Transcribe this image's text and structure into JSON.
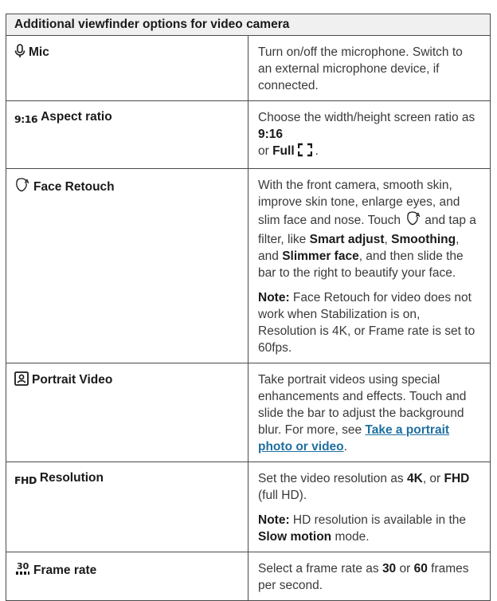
{
  "table": {
    "header": "Additional viewfinder options for video camera",
    "rows": [
      {
        "icon": "mic-icon",
        "label": "Mic",
        "desc": "Turn on/off the microphone. Switch to an external microphone device, if connected."
      },
      {
        "icon_text": "9:16",
        "label": "Aspect ratio",
        "desc_prefix": "Choose the width/height screen ratio as ",
        "opt1": "9:16",
        "or": " or ",
        "opt2": "Full"
      },
      {
        "icon": "face-retouch-icon",
        "label": "Face Retouch",
        "p1": "With the front camera, smooth skin, improve skin tone, enlarge eyes, and slim face and nose.",
        "p1b_start": "Touch",
        "p1b_mid": "and tap a filter, like",
        "smart": "Smart adjust",
        "comma": ",",
        "smoothing": "Smoothing",
        "and": ", and",
        "slimmer": "Slimmer face",
        "p1b_end": ", and then slide the bar to the right to beautify your face.",
        "note_label": "Note:",
        "note": " Face Retouch for video does not work when Stabilization is on, Resolution is 4K, or Frame rate is set to 60fps."
      },
      {
        "icon": "portrait-icon",
        "label": "Portrait Video",
        "desc": "Take portrait videos using special enhancements and effects. Touch and slide the bar to adjust the background blur. For more, see",
        "link": "Take a portrait photo or video",
        "period": "."
      },
      {
        "icon_text": "FHD",
        "label": "Resolution",
        "desc_prefix": "Set the video resolution as ",
        "opt1": "4K",
        "or": ", or ",
        "opt2": "FHD",
        "desc_suffix": " (full HD).",
        "note_label": "Note:",
        "note": " HD resolution is available in the ",
        "note_bold": "Slow motion",
        "note_end": " mode."
      },
      {
        "icon": "frame-rate-icon",
        "label": "Frame rate",
        "desc_prefix": "Select a frame rate as ",
        "opt1": "30",
        "or": " or ",
        "opt2": "60",
        "desc_suffix": " frames per second."
      }
    ]
  },
  "colors": {
    "link": "#1f6f9f",
    "border": "#4a4a4a",
    "header_bg": "#f0f0f0"
  }
}
